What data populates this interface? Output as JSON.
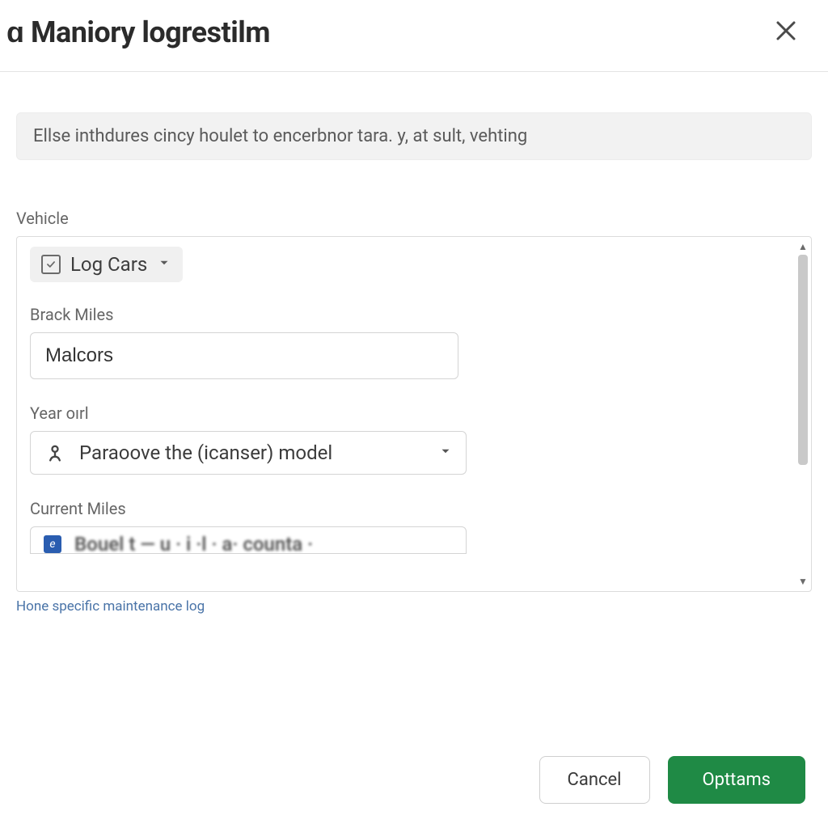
{
  "header": {
    "title": "ɑ Maniory logrestilm"
  },
  "banner": {
    "text": "Ellse inthdures cincy houlet to encerbnor tara. y, at sult, vehting"
  },
  "form": {
    "vehicle_label": "Vehicle",
    "vehicle_chip": "Log Cars",
    "brack_miles_label": "Brack Miles",
    "brack_miles_value": "Malcors",
    "year_label": "Year oırl",
    "year_value": "Paraoove the (icanser) model",
    "current_miles_label": "Current Miles",
    "current_miles_partial": "Bouel t — u · i ·l · a· counta ·"
  },
  "helper_link": "Hone specific maintenance log",
  "footer": {
    "cancel": "Cancel",
    "primary": "Opttams"
  }
}
